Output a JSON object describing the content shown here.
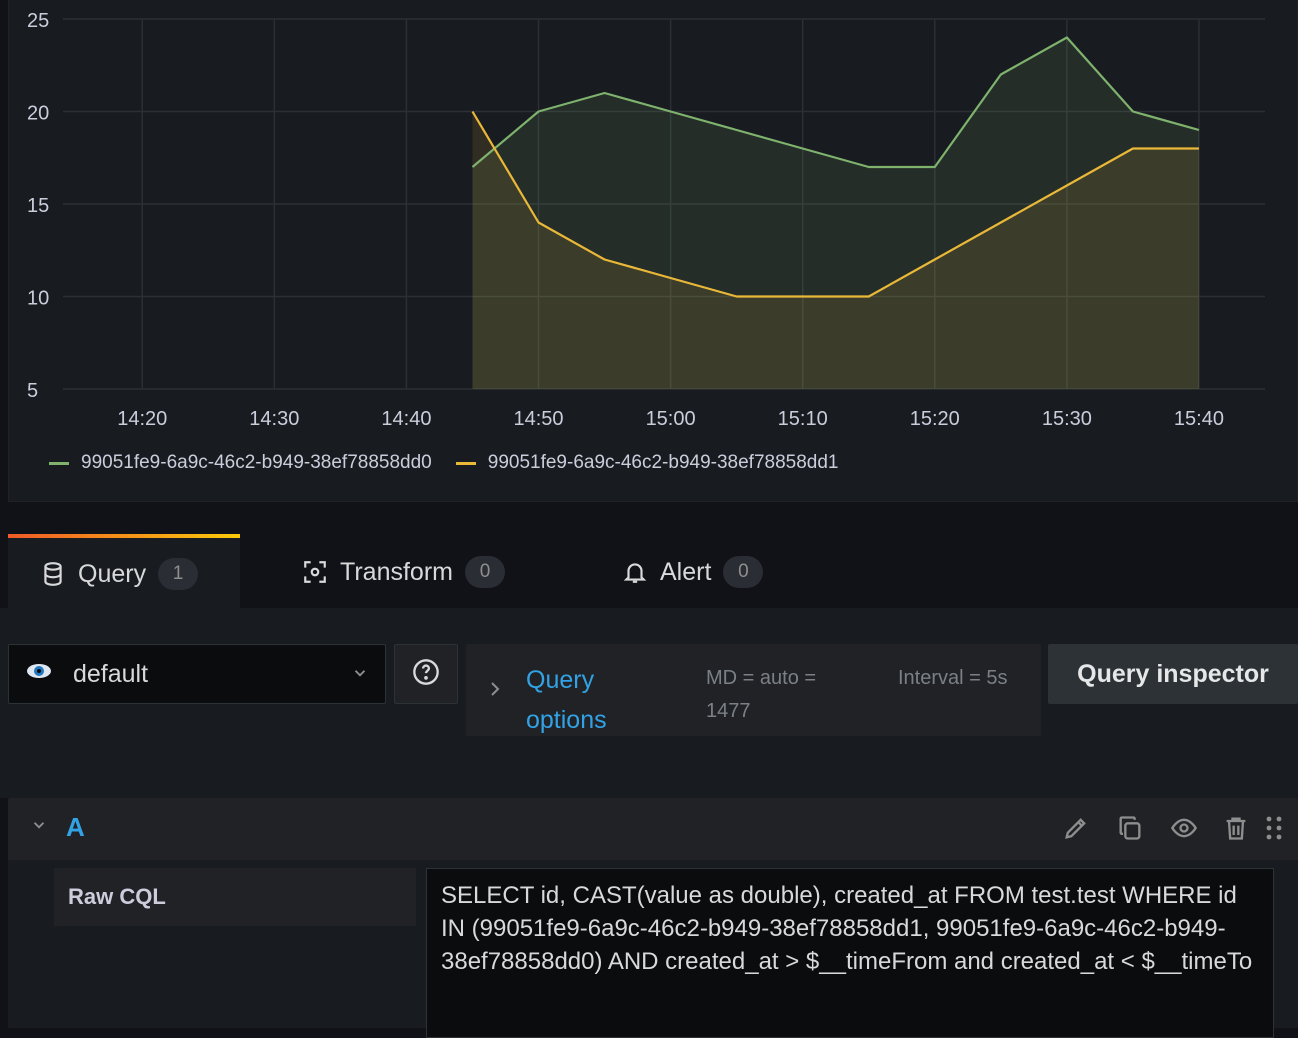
{
  "chart_data": {
    "type": "line",
    "y_ticks": [
      "25",
      "20",
      "15",
      "10",
      "5"
    ],
    "x_ticks": [
      "14:20",
      "14:30",
      "14:40",
      "14:50",
      "15:00",
      "15:10",
      "15:20",
      "15:30",
      "15:40"
    ],
    "ylim": [
      5,
      25
    ],
    "xlim": [
      "14:14",
      "15:45"
    ],
    "grid": true,
    "legend": "bottom-left",
    "series": [
      {
        "name": "99051fe9-6a9c-46c2-b949-38ef78858dd0",
        "color": "#7eb26d",
        "x": [
          "14:45",
          "14:50",
          "14:55",
          "15:00",
          "15:05",
          "15:10",
          "15:15",
          "15:20",
          "15:25",
          "15:30",
          "15:35",
          "15:40"
        ],
        "values": [
          17,
          20,
          21,
          20,
          19,
          18,
          17,
          17,
          22,
          24,
          20,
          19
        ]
      },
      {
        "name": "99051fe9-6a9c-46c2-b949-38ef78858dd1",
        "color": "#eab839",
        "x": [
          "14:45",
          "14:50",
          "14:55",
          "15:00",
          "15:05",
          "15:10",
          "15:15",
          "15:20",
          "15:25",
          "15:30",
          "15:35",
          "15:40"
        ],
        "values": [
          20,
          14,
          12,
          11,
          10,
          10,
          10,
          12,
          14,
          16,
          18,
          18
        ]
      }
    ]
  },
  "tabs": [
    {
      "label": "Query",
      "count": "1",
      "icon": "database-icon"
    },
    {
      "label": "Transform",
      "count": "0",
      "icon": "transform-icon"
    },
    {
      "label": "Alert",
      "count": "0",
      "icon": "bell-icon"
    }
  ],
  "datasource": {
    "label": "default"
  },
  "query_options": {
    "title": "Query options",
    "md": "MD = auto = 1477",
    "interval": "Interval = 5s"
  },
  "query_inspector": {
    "label": "Query inspector"
  },
  "query": {
    "ref_id": "A",
    "editor_label": "Raw CQL",
    "cql": "SELECT id, CAST(value as double), created_at FROM test.test WHERE id IN (99051fe9-6a9c-46c2-b949-38ef78858dd1, 99051fe9-6a9c-46c2-b949-38ef78858dd0) AND created_at > $__timeFrom and created_at < $__timeTo"
  },
  "colors": {
    "accent": "#33a2e5",
    "background": "#111217",
    "panel": "#181b1f"
  }
}
